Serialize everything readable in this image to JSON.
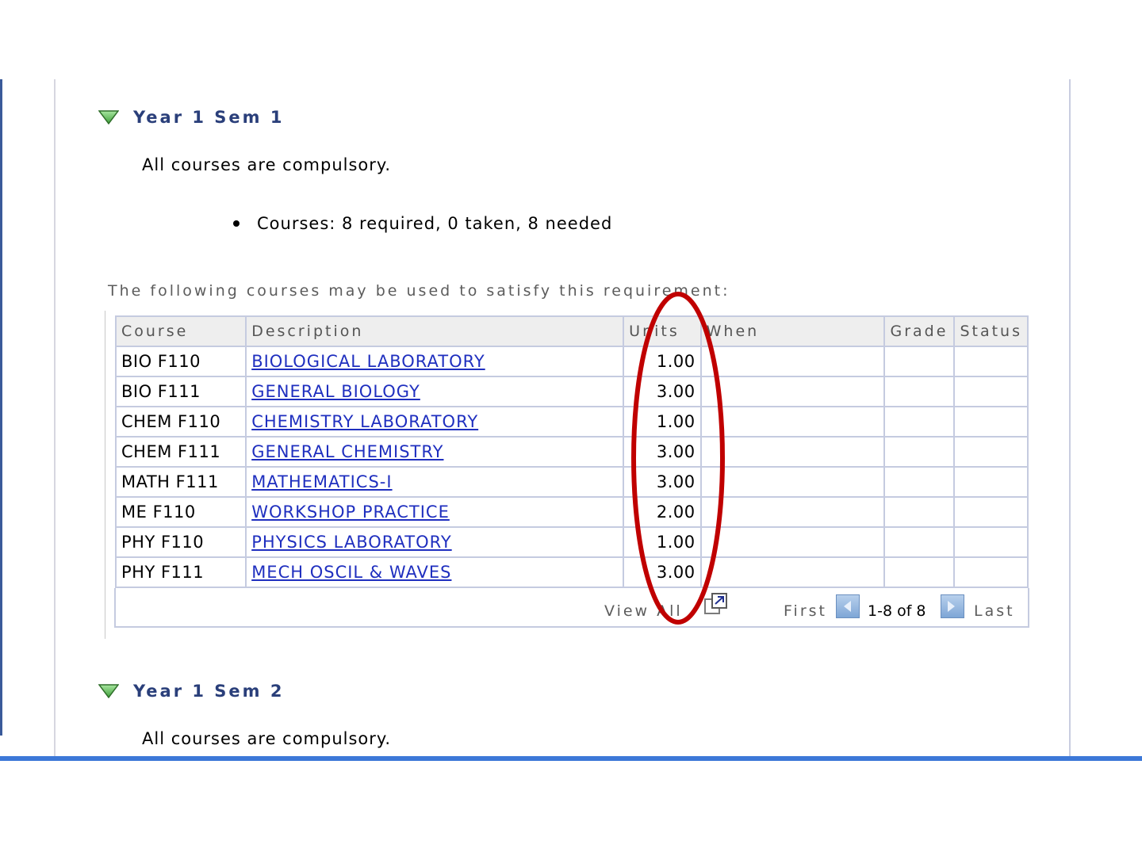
{
  "sections": [
    {
      "title": "Year 1 Sem 1",
      "note": "All courses are compulsory.",
      "requirement": "Courses: 8 required, 0 taken, 8 needed"
    },
    {
      "title": "Year 1 Sem 2",
      "note": "All courses are compulsory."
    }
  ],
  "intro": "The following courses may be used to satisfy this requirement:",
  "table": {
    "headers": [
      "Course",
      "Description",
      "Units",
      "When",
      "Grade",
      "Status"
    ],
    "rows": [
      {
        "course": "BIO F110",
        "description": "BIOLOGICAL LABORATORY",
        "units": "1.00"
      },
      {
        "course": "BIO F111",
        "description": "GENERAL BIOLOGY",
        "units": "3.00"
      },
      {
        "course": "CHEM F110",
        "description": "CHEMISTRY LABORATORY",
        "units": "1.00"
      },
      {
        "course": "CHEM F111",
        "description": "GENERAL CHEMISTRY",
        "units": "3.00"
      },
      {
        "course": "MATH F111",
        "description": "MATHEMATICS-I",
        "units": "3.00"
      },
      {
        "course": "ME F110",
        "description": "WORKSHOP PRACTICE",
        "units": "2.00"
      },
      {
        "course": "PHY F110",
        "description": "PHYSICS LABORATORY",
        "units": "1.00"
      },
      {
        "course": "PHY F111",
        "description": "MECH OSCIL & WAVES",
        "units": "3.00"
      }
    ]
  },
  "footer": {
    "view_all": "View All",
    "first": "First",
    "range": "1-8 of 8",
    "last": "Last"
  },
  "colors": {
    "section_title": "#2a3f7a",
    "link": "#1f2fbf",
    "annotation": "#c00000"
  },
  "icons": {
    "collapse": "triangle-down-icon",
    "popup": "new-window-icon",
    "prev": "arrow-left-icon",
    "next": "arrow-right-icon"
  }
}
